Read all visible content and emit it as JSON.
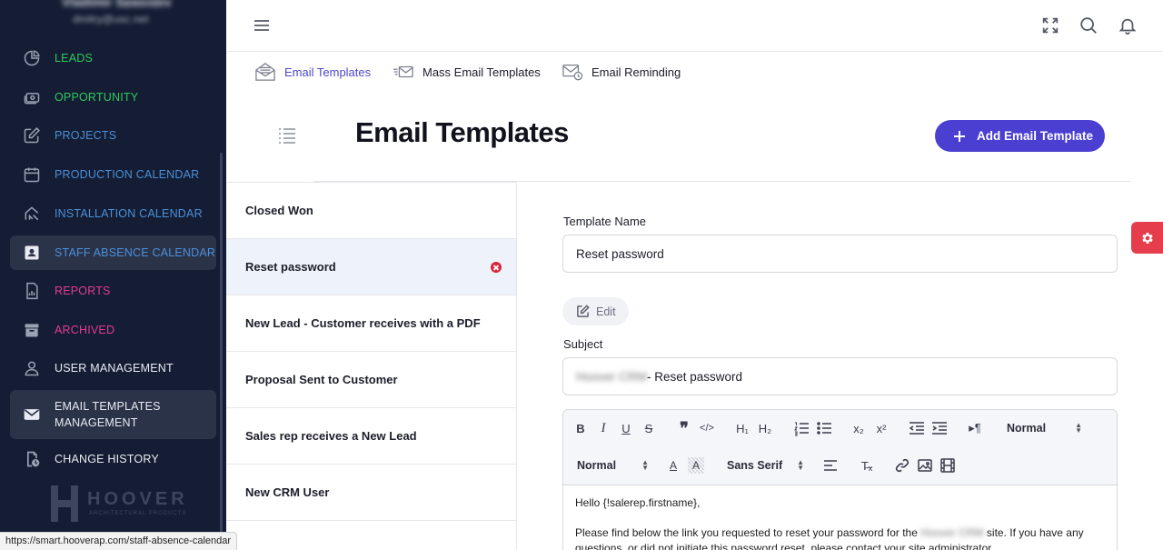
{
  "user": {
    "name": "Vladimir Spasojevic",
    "email": "dmitry@usc.net"
  },
  "sidebar": {
    "items": [
      {
        "label": "LEADS",
        "color": "#2ec95c"
      },
      {
        "label": "OPPORTUNITY",
        "color": "#2ec95c"
      },
      {
        "label": "PROJECTS",
        "color": "#4a90d9"
      },
      {
        "label": "PRODUCTION CALENDAR",
        "color": "#4a90d9"
      },
      {
        "label": "INSTALLATION CALENDAR",
        "color": "#4a90d9"
      },
      {
        "label": "STAFF ABSENCE CALENDAR",
        "color": "#4a90d9"
      },
      {
        "label": "REPORTS",
        "color": "#e23c8c"
      },
      {
        "label": "ARCHIVED",
        "color": "#e23c8c"
      },
      {
        "label": "USER MANAGEMENT",
        "color": "#e8ebf2"
      },
      {
        "label": "EMAIL TEMPLATES MANAGEMENT",
        "color": "#e8ebf2"
      },
      {
        "label": "CHANGE HISTORY",
        "color": "#e8ebf2"
      }
    ],
    "logo": {
      "text": "HOOVER",
      "subtitle": "ARCHITECTURAL PRODUCTS"
    }
  },
  "status_bar_url": "https://smart.hooverap.com/staff-absence-calendar",
  "tabs": [
    {
      "label": "Email Templates",
      "active": true
    },
    {
      "label": "Mass Email Templates",
      "active": false
    },
    {
      "label": "Email Reminding",
      "active": false
    }
  ],
  "page": {
    "title": "Email Templates",
    "add_button_label": "Add Email Template"
  },
  "templates": [
    {
      "name": "Closed Won"
    },
    {
      "name": "Reset password",
      "selected": true
    },
    {
      "name": "New Lead - Customer receives with a PDF"
    },
    {
      "name": "Proposal Sent to Customer"
    },
    {
      "name": "Sales rep receives a New Lead"
    },
    {
      "name": "New CRM User"
    }
  ],
  "form": {
    "template_name_label": "Template Name",
    "template_name_value": "Reset password",
    "edit_label": "Edit",
    "subject_label": "Subject",
    "subject_prefix": "Hoover CRM",
    "subject_value": " - Reset password"
  },
  "editor": {
    "header_select": "Normal",
    "size_select": "Normal",
    "font_select": "Sans Serif",
    "body_line1": "Hello {!salerep.firstname},",
    "body_line2_a": "Please find below the link you requested to reset your password for the ",
    "body_line2_blur": "Hoover CRM",
    "body_line2_b": " site. If you have any",
    "body_line3": "questions, or did not initiate this password reset, please contact your site administrator."
  },
  "colors": {
    "sidebar_bg": "#141d33",
    "accent": "#4a3fd0",
    "danger": "#e53d4b"
  }
}
